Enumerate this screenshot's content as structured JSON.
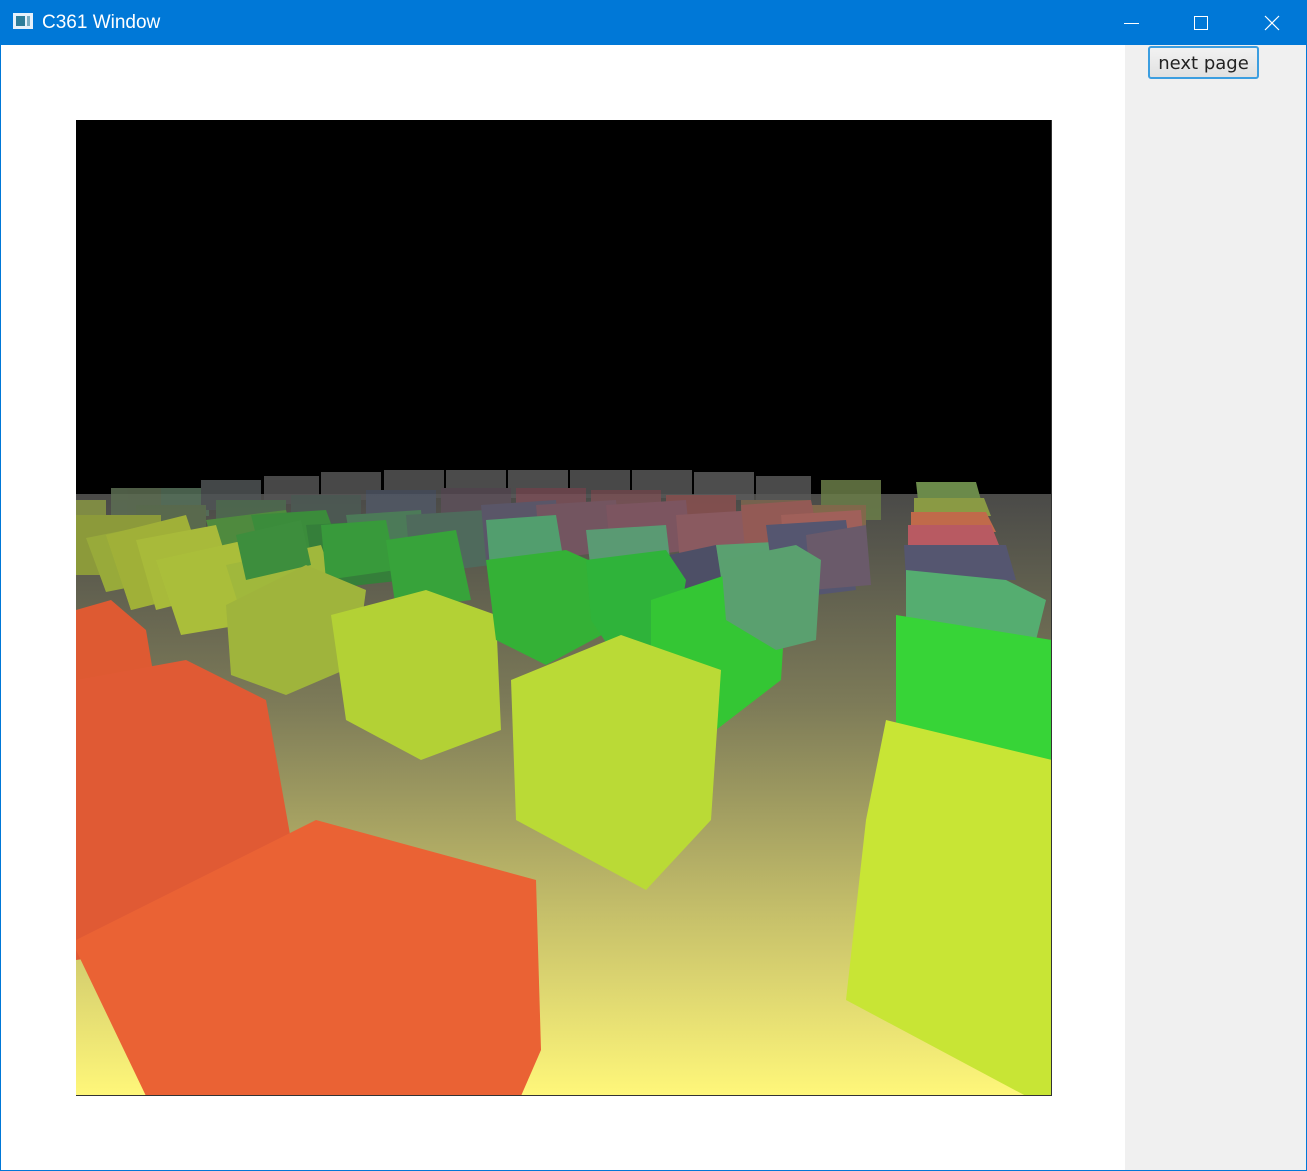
{
  "window": {
    "title": "C361 Window",
    "icon": "window-app-icon",
    "controls": [
      {
        "name": "minimize",
        "icon": "minimize-icon"
      },
      {
        "name": "maximize",
        "icon": "maximize-icon"
      },
      {
        "name": "close",
        "icon": "close-icon"
      }
    ],
    "accent_color": "#0078d7"
  },
  "sidebar": {
    "next_button_label": "next page"
  },
  "scene": {
    "description_hidden": true,
    "sky_color": "#000000",
    "ground_gradient": [
      "#4a4a48",
      "#fff77a"
    ],
    "cube_colors": [
      "#e85a30",
      "#b8d835",
      "#36c836",
      "#5aa86e",
      "#54566e",
      "#c25a5a"
    ]
  }
}
